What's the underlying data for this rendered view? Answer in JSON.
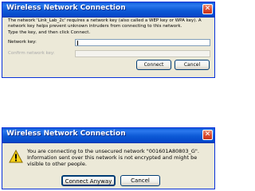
{
  "dialog_key": {
    "title": "Wireless Network Connection",
    "close_glyph": "✕",
    "message": "The network 'Link_Lab_2c' requires a network key (also called a WEP key or WPA key). A network key helps prevent unknown intruders from connecting to this network.",
    "hint": "Type the key, and then click Connect.",
    "network_key_label": "Network key:",
    "network_key_value": "",
    "confirm_key_label": "Confirm network key:",
    "confirm_key_value": "",
    "connect_label": "Connect",
    "cancel_label": "Cancel"
  },
  "dialog_unsecured": {
    "title": "Wireless Network Connection",
    "close_glyph": "✕",
    "message": "You are connecting to the unsecured network \"001601A80803_G\". Information sent over this network is not encrypted and might be visible to other people.",
    "connect_anyway_label": "Connect Anyway",
    "cancel_label": "Cancel",
    "icon": "warning-icon"
  },
  "colors": {
    "titlebar": "#0a5cd8",
    "dialog_bg": "#ece9d8",
    "warning": "#f7d117",
    "close_button": "#d9472b"
  }
}
